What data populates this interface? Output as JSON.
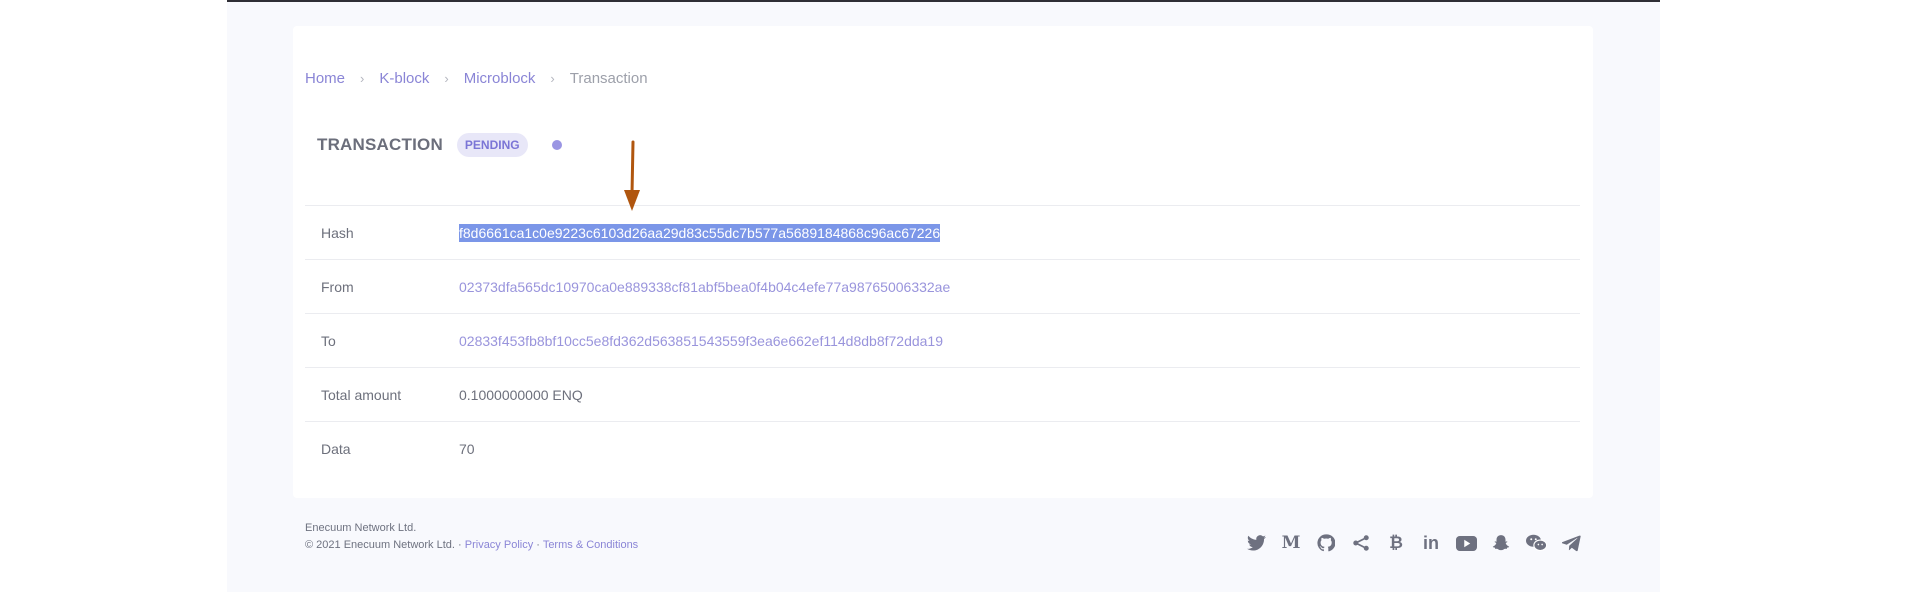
{
  "breadcrumb": {
    "items": [
      "Home",
      "K-block",
      "Microblock"
    ],
    "current": "Transaction",
    "separator": "›"
  },
  "transaction": {
    "title": "TRANSACTION",
    "status": "PENDING",
    "rows": [
      {
        "label": "Hash",
        "value": "f8d6661ca1c0e9223c6103d26aa29d83c55dc7b577a5689184868c96ac67226"
      },
      {
        "label": "From",
        "value": "02373dfa565dc10970ca0e889338cf81abf5bea0f4b04c4efe77a98765006332ae"
      },
      {
        "label": "To",
        "value": "02833f453fb8bf10cc5e8fd362d563851543559f3ea6e662ef114d8db8f72dda19"
      },
      {
        "label": "Total amount",
        "value": "0.1000000000 ENQ"
      },
      {
        "label": "Data",
        "value": "70"
      }
    ]
  },
  "footer": {
    "company": "Enecuum Network Ltd.",
    "copyright": "© 2021 Enecuum Network Ltd. ·",
    "privacy": "Privacy Policy",
    "separator": "·",
    "terms": "Terms & Conditions"
  },
  "social": {
    "icons": [
      "twitter-icon",
      "medium-icon",
      "github-icon",
      "share-icon",
      "bitcoin-icon",
      "linkedin-icon",
      "youtube-icon",
      "snapchat-icon",
      "wechat-icon",
      "telegram-icon"
    ],
    "medium_glyph": "M",
    "bitcoin_glyph": "₿",
    "linkedin_glyph": "in"
  },
  "colors": {
    "accent": "#8a85d6",
    "selection": "#7b96e8",
    "arrow": "#b0560f",
    "status_dot": "#9a95e3"
  }
}
